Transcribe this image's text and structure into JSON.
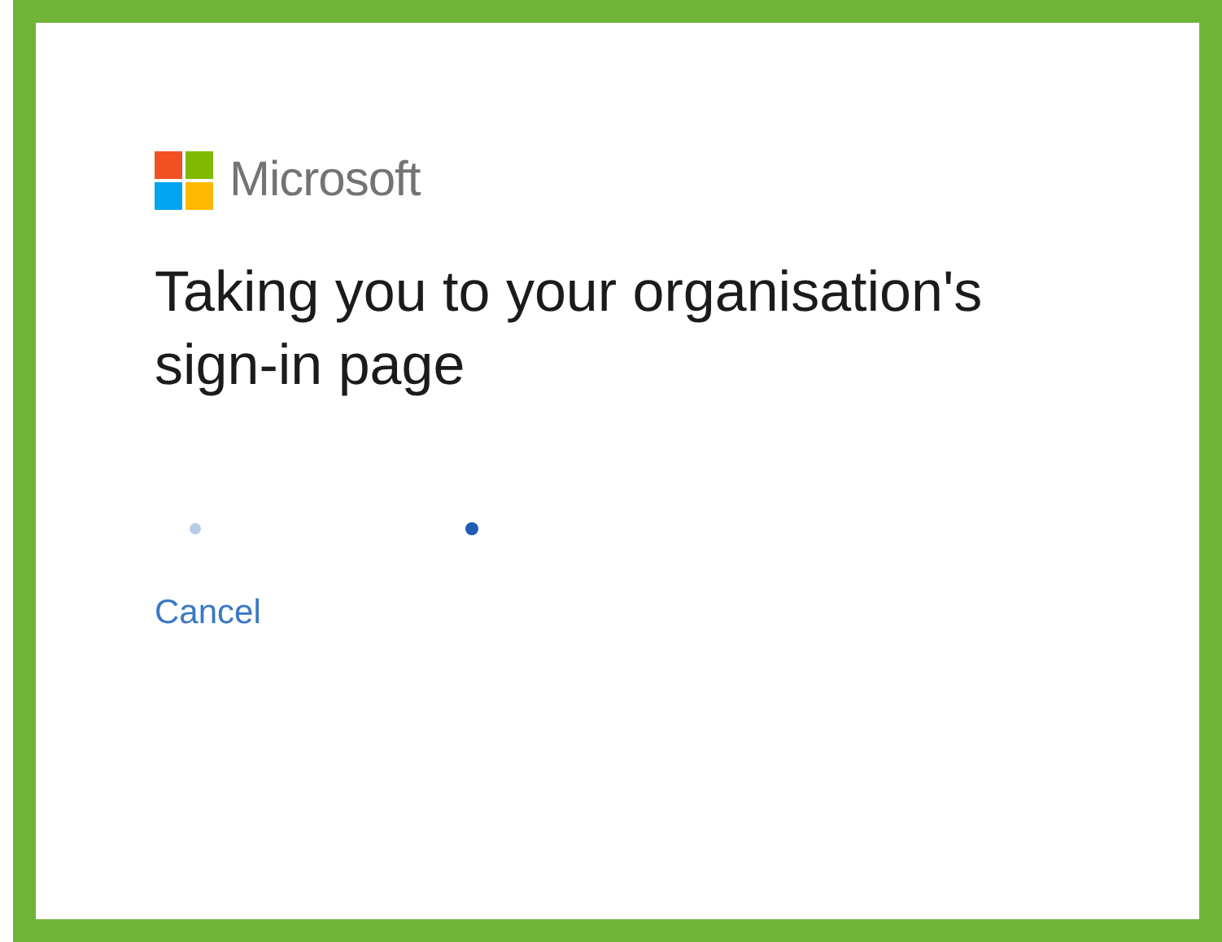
{
  "brand": {
    "name": "Microsoft"
  },
  "title": "Taking you to your organisation's sign-in page",
  "cancel_link": "Cancel"
}
